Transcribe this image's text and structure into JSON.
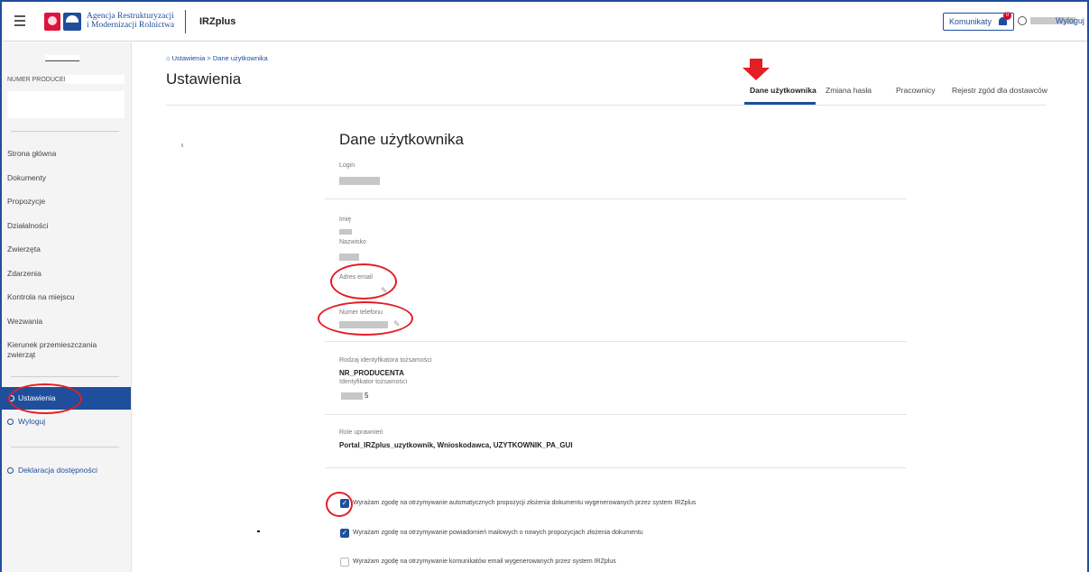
{
  "header": {
    "agency_line1": "Agencja Restrukturyzacji",
    "agency_line2": "i Modernizacji Rolnictwa",
    "app_name": "IRZplus",
    "messages_label": "Komunikaty",
    "messages_count": "0",
    "logout_label": "Wyloguj",
    "accent_color": "#1f4e9c",
    "brand_red": "#c8102e"
  },
  "sidebar": {
    "producer_label": "NUMER PRODUCENTA:",
    "items": [
      {
        "label": "Strona główna"
      },
      {
        "label": "Dokumenty"
      },
      {
        "label": "Propozycje"
      },
      {
        "label": "Działalności"
      },
      {
        "label": "Zwierzęta"
      },
      {
        "label": "Zdarzenia"
      },
      {
        "label": "Kontrola na miejscu"
      },
      {
        "label": "Wezwania"
      },
      {
        "label": "Kierunek przemieszczania zwierząt"
      }
    ],
    "settings_label": "Ustawienia",
    "logout_label": "Wyloguj",
    "accessibility_label": "Deklaracja dostępności"
  },
  "main": {
    "breadcrumb": "Ustawienia  >  Dane użytkownika",
    "page_title": "Ustawienia",
    "tabs": [
      {
        "label": "Dane użytkownika",
        "active": true
      },
      {
        "label": "Zmiana hasła",
        "active": false
      },
      {
        "label": "Pracownicy",
        "active": false
      },
      {
        "label": "Rejestr zgód dla dostawców",
        "active": false
      }
    ],
    "section_title": "Dane użytkownika",
    "fields": {
      "login_label": "Login",
      "first_name_label": "Imię",
      "last_name_label": "Nazwisko",
      "email_label": "Adres email",
      "phone_label": "Numer telefonu",
      "id_type_label": "Rodzaj identyfikatora tożsamości",
      "id_type_value": "NR_PRODUCENTA",
      "id_label": "Identyfikator tożsamości",
      "roles_label": "Role uprawnień",
      "roles_value": "Portal_IRZplus_uzytkownik, Wnioskodawca, UZYTKOWNIK_PA_GUI"
    },
    "consents": [
      {
        "label": "Wyrażam zgodę na otrzymywanie automatycznych propozycji złożenia dokumentu wygenerowanych przez system IRZplus",
        "checked": true
      },
      {
        "label": "Wyrażam zgodę na otrzymywanie powiadomień mailowych o nowych propozycjach złożenia dokumentu",
        "checked": true
      },
      {
        "label": "Wyrażam zgodę na otrzymywanie komunikatów email wygenerowanych przez system IRZplus",
        "checked": false
      }
    ],
    "annotation_color": "#e31e24"
  }
}
